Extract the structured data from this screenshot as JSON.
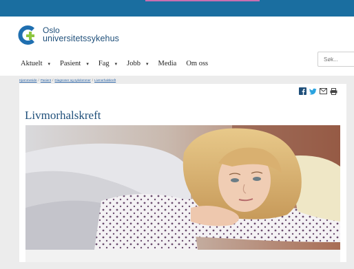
{
  "site": {
    "logo_line1": "Oslo",
    "logo_line2": "universitetssykehus",
    "brand_color": "#1f4f7a",
    "topbar_color": "#1a6ea0"
  },
  "nav": {
    "items": [
      {
        "label": "Aktuelt",
        "has_dropdown": true
      },
      {
        "label": "Pasient",
        "has_dropdown": true
      },
      {
        "label": "Fag",
        "has_dropdown": true
      },
      {
        "label": "Jobb",
        "has_dropdown": true
      },
      {
        "label": "Media",
        "has_dropdown": false
      },
      {
        "label": "Om oss",
        "has_dropdown": false
      }
    ],
    "caret": "▾"
  },
  "search": {
    "placeholder": "Søk..."
  },
  "breadcrumb": {
    "items": [
      "Hjemmeside",
      "Pasient",
      "Diagnoser og sykdommer",
      "Livmorhalskreft"
    ],
    "separator": "/"
  },
  "share": {
    "icons": [
      "facebook-icon",
      "twitter-icon",
      "email-icon",
      "print-icon"
    ]
  },
  "article": {
    "title": "Livmorhalskreft"
  }
}
